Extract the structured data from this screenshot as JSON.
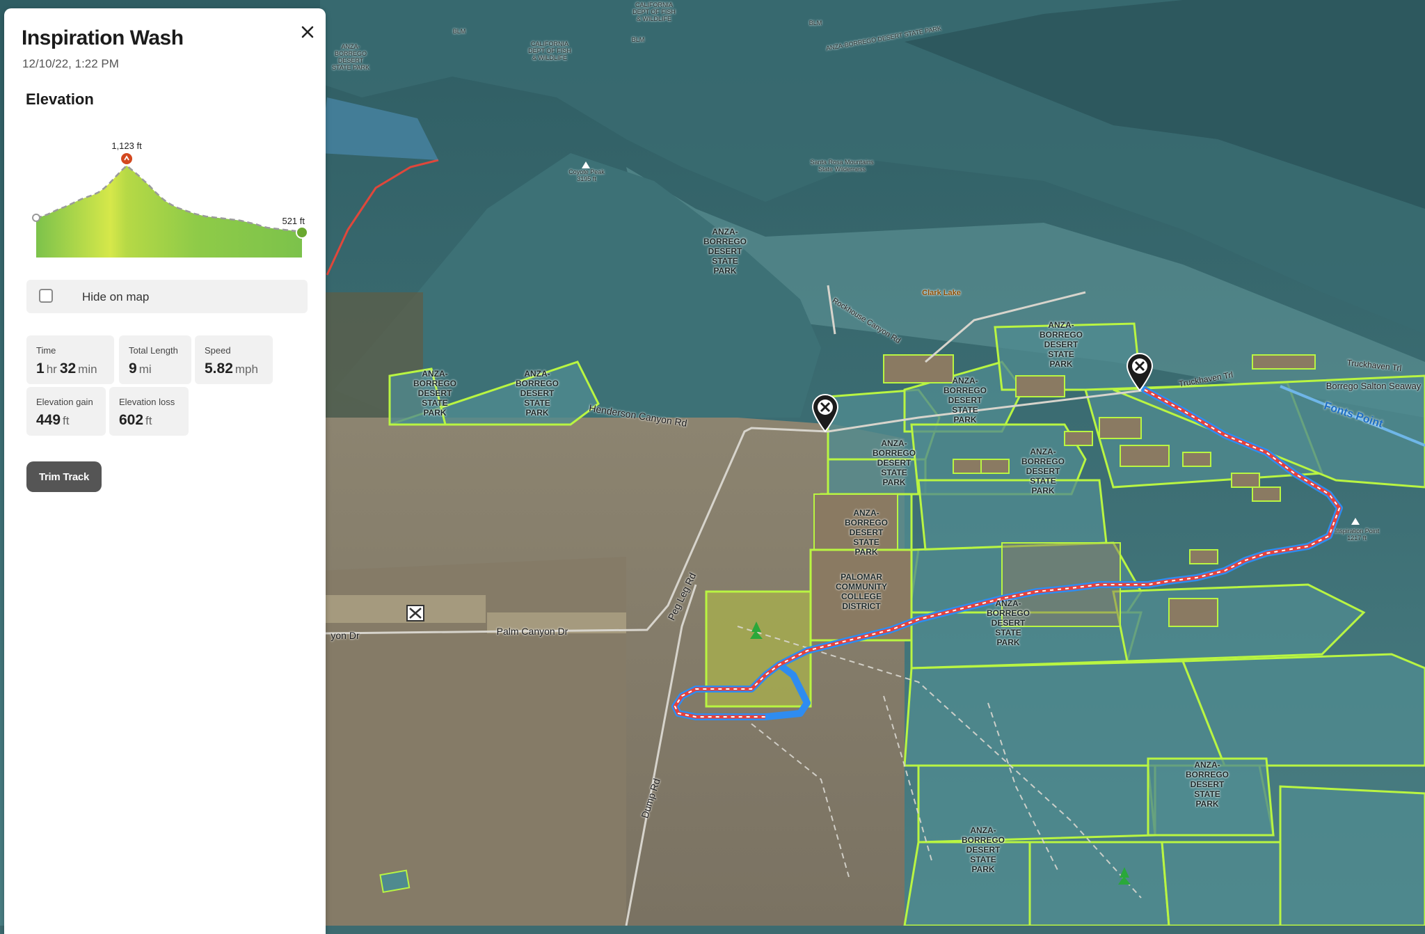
{
  "panel": {
    "title": "Inspiration Wash",
    "timestamp": "12/10/22, 1:22 PM",
    "close_icon": "close-icon",
    "elevation": {
      "heading": "Elevation",
      "max_label": "1,123 ft",
      "end_label": "521 ft",
      "profile": [
        0.22,
        0.24,
        0.27,
        0.31,
        0.35,
        0.38,
        0.42,
        0.46,
        0.5,
        0.53,
        0.56,
        0.6,
        0.66,
        0.74,
        0.83,
        0.92,
        1.0,
        0.93,
        0.86,
        0.78,
        0.7,
        0.61,
        0.53,
        0.46,
        0.41,
        0.37,
        0.34,
        0.31,
        0.28,
        0.26,
        0.24,
        0.23,
        0.22,
        0.21,
        0.2,
        0.19,
        0.18,
        0.16,
        0.14,
        0.12,
        0.09,
        0.07,
        0.06,
        0.05,
        0.04,
        0.03,
        0.02,
        0.0
      ]
    },
    "hide_on_map": {
      "label": "Hide on map",
      "checked": false
    },
    "stats": {
      "time": {
        "label": "Time",
        "hours": "1",
        "hours_unit": "hr",
        "minutes": "32",
        "minutes_unit": "min"
      },
      "length": {
        "label": "Total Length",
        "value": "9",
        "unit": "mi"
      },
      "speed": {
        "label": "Speed",
        "value": "5.82",
        "unit": "mph"
      },
      "gain": {
        "label": "Elevation gain",
        "value": "449",
        "unit": "ft"
      },
      "loss": {
        "label": "Elevation loss",
        "value": "602",
        "unit": "ft"
      }
    },
    "trim_button": "Trim Track"
  },
  "map": {
    "colors": {
      "public_land": "#4f8a8f",
      "boundary": "#b9f542",
      "track_blue": "#2f8cf0",
      "track_red": "#e8403a"
    },
    "labels": {
      "anza_1": "ANZA-\nBORREGO\nDESERT\nSTATE PARK",
      "anza_2": "ANZA-\nBORREGO\nDESERT\nSTATE PARK",
      "anza_3": "ANZA-\nBORREGO\nDESERT\nSTATE PARK",
      "anza_4": "ANZA-\nBORREGO\nDESERT\nSTATE PARK",
      "anza_5": "ANZA-\nBORREGO\nDESERT\nSTATE PARK",
      "anza_6": "ANZA-\nBORREGO\nDESERT\nSTATE PARK",
      "anza_7": "ANZA-\nBORREGO\nDESERT\nSTATE PARK",
      "anza_8": "ANZA-\nBORREGO\nDESERT\nSTATE PARK",
      "anza_9": "ANZA-\nBORREGO\nDESERT\nSTATE PARK",
      "anza_10": "ANZA-\nBORREGO\nDESERT\nSTATE PARK",
      "anza_11": "ANZA-\nBORREGO\nDESERT\nSTATE PARK",
      "anza_12": "ANZA-\nBORREGO\nDESERT\nSTATE PARK",
      "anza_top": "ANZA-\nBORREGO\nDESERT\nSTATE PARK",
      "palomar": "PALOMAR\nCOMMUNITY\nCOLLEGE\nDISTRICT",
      "santa_rosa": "Santa Rosa Mountains\nState Wilderness",
      "coyote_peak": "Coyote Peak\n3195 ft",
      "inspiration_point": "Inspiration Point\n1217 ft",
      "clark_lake": "Clark Lake",
      "henderson": "Henderson Canyon Rd",
      "palm_canyon": "Palm Canyon Dr",
      "palm_canyon_left": "yon Dr",
      "peg_leg": "Peg Leg Rd",
      "dump": "Dump Rd",
      "rockhouse": "Rockhouse Canyon Rd",
      "truckhaven": "Truckhaven Trl",
      "truckhaven_r": "Truckhaven Trl",
      "borrego_salton": "Borrego Salton Seaway",
      "fonts_point": "Fonts Point",
      "ca_fish_1": "CALIFORNIA\nDEPT OF FISH\n& WILDLIFE",
      "ca_fish_2": "CALIFORNIA\nDEPT OF FISH\n& WILDLIFE",
      "blm_1": "BLM",
      "blm_2": "BLM",
      "blm_3": "BLM",
      "anza_ridge": "ANZA-BORREGO DESERT STATE PARK"
    }
  }
}
